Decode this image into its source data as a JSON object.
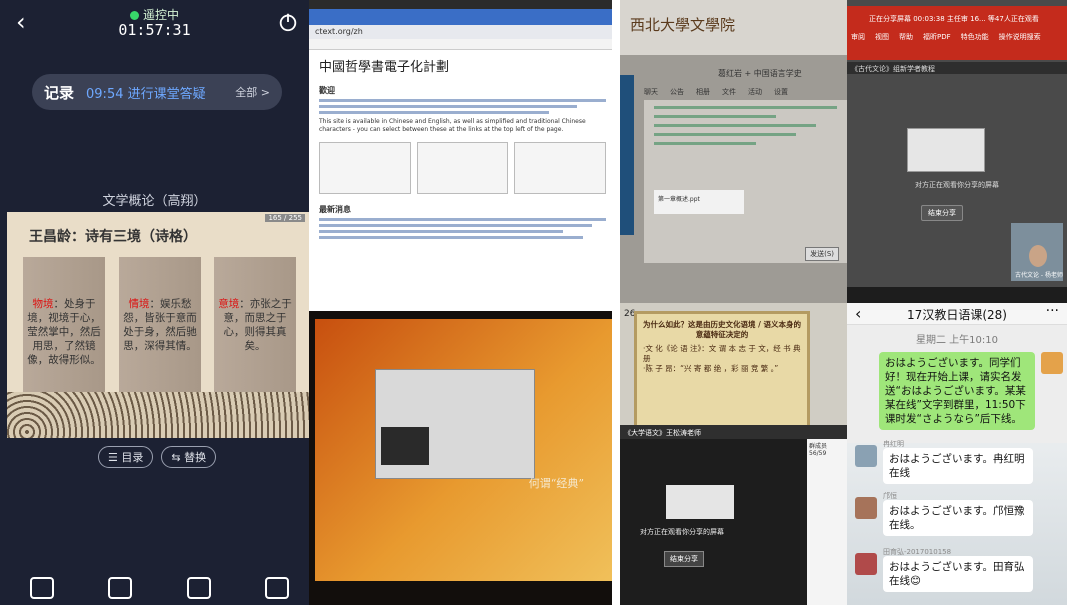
{
  "remote": {
    "status": "遥控中",
    "timer": "01:57:31",
    "record_label": "记录",
    "record_value": "09:54 进行课堂答疑",
    "record_all": "全部 >",
    "course": "文学概论（高翔）",
    "slide_page": "165 / 255",
    "slide_title": "王昌龄：诗有三境（诗格）",
    "card1_key": "物境",
    "card1_text": "：处身于境，视境于心，莹然掌中，然后用思，了然镜像，故得形似。",
    "card2_key": "情境",
    "card2_text": "：娱乐愁怨，皆张于意而处于身，然后驰思，深得其情。",
    "card3_key": "意境",
    "card3_text": "：亦张之于意，而思之于心，则得其真矣。",
    "btn_toc": "☰ 目录",
    "btn_switch": "⇆ 替换"
  },
  "browser": {
    "address": "ctext.org/zh",
    "site_title": "中國哲學書電子化計劃",
    "section_intro": "歡迎",
    "section_news": "最新消息",
    "english": "This site is available in Chinese and English, as well as simplified and traditional Chinese characters - you can select between these at the links at the top left of the page.",
    "quote": "何谓“经典”"
  },
  "laptop_app": {
    "school_logo": "西北大學文學院",
    "title": "葛红岩 + 中国语言学史",
    "tabs": [
      "聊天",
      "公告",
      "相册",
      "文件",
      "活动",
      "设置"
    ],
    "file_name": "第一章概述.ppt",
    "send": "发送(S)"
  },
  "meeting": {
    "top_text": "正在分享屏幕 00:03:38 主任审 16... 等47人正在观看",
    "ribbon_tabs": [
      "审阅",
      "视图",
      "帮助",
      "福昕PDF",
      "特色功能",
      "操作说明搜索"
    ],
    "window_title": "《古代文论》组新学者教程",
    "capture": "对方正在观看你分享的屏幕",
    "end_share": "结束分享",
    "cam_name": "古代文论 - 杨老师"
  },
  "phone_photo": {
    "number": "26",
    "heading": "为什么如此？这是由历史文化语境 / 语义本身的意蕴特征决定的",
    "bullet1": "·文 化《论 语 注》：文 谓 本 志 于 文，经 书 典 册",
    "bullet2": "·陈 子 昂：“兴 寄 都 绝 ，彩 丽 竞 繁 。”",
    "header": "《大学语文》王松涛老师",
    "capture": "对方正在观看你分享的屏幕",
    "stop": "结束分享",
    "group_count": "群成员 56/59"
  },
  "wechat": {
    "title": "17汉教日语课(28)",
    "date": "星期二 上午10:10",
    "my_msg": "おはようございます。同学们好！现在开始上课，请实名发送“おはようございます。某某某在线”文字到群里，11:50下课时发“さようなら”后下线。",
    "m1_name": "冉红明",
    "m1_text": "おはようございます。冉红明在线",
    "m2_name": "邝恒",
    "m2_text": "おはようございます。邝恒豫在线。",
    "m3_name": "田育弘-2017010158",
    "m3_text": "おはようございます。田育弘在线😊"
  },
  "colors": {
    "remote_bg": "#1c2133",
    "accent_blue": "#6ea8ff",
    "wechat_green": "#9fe67a",
    "ppt_red": "#c42b1c"
  }
}
